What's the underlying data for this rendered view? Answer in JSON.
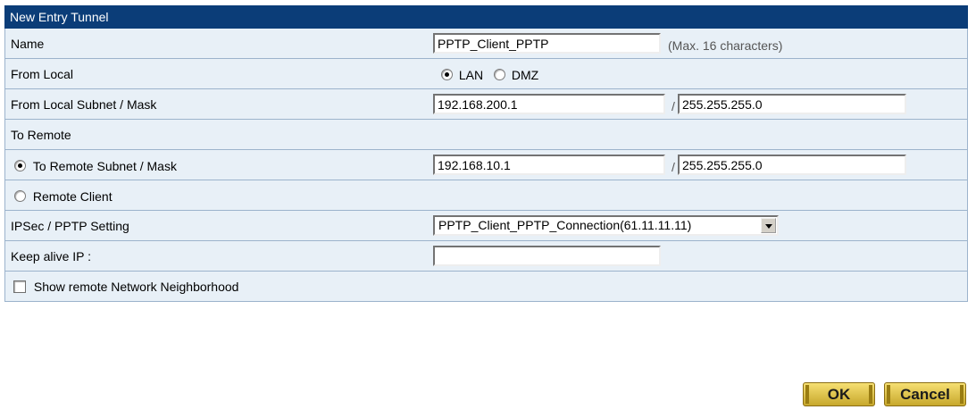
{
  "title": "New Entry Tunnel",
  "name": {
    "label": "Name",
    "value": "PPTP_Client_PPTP",
    "hint": "(Max. 16 characters)"
  },
  "from_local": {
    "label": "From Local",
    "options": [
      "LAN",
      "DMZ"
    ],
    "selected": "LAN"
  },
  "from_local_subnet": {
    "label": "From Local Subnet / Mask",
    "subnet": "192.168.200.1",
    "sep": "/",
    "mask": "255.255.255.0"
  },
  "to_remote": {
    "label": "To Remote"
  },
  "to_remote_subnet": {
    "label": "To Remote Subnet / Mask",
    "subnet": "192.168.10.1",
    "sep": "/",
    "mask": "255.255.255.0",
    "selected": true
  },
  "remote_client": {
    "label": "Remote Client",
    "selected": false
  },
  "ipsec_pptp": {
    "label": "IPSec / PPTP Setting",
    "value": "PPTP_Client_PPTP_Connection(61.11.11.11)"
  },
  "keep_alive": {
    "label": "Keep alive IP :",
    "value": ""
  },
  "show_neighborhood": {
    "label": "Show remote Network Neighborhood",
    "checked": false
  },
  "buttons": {
    "ok": "OK",
    "cancel": "Cancel"
  }
}
